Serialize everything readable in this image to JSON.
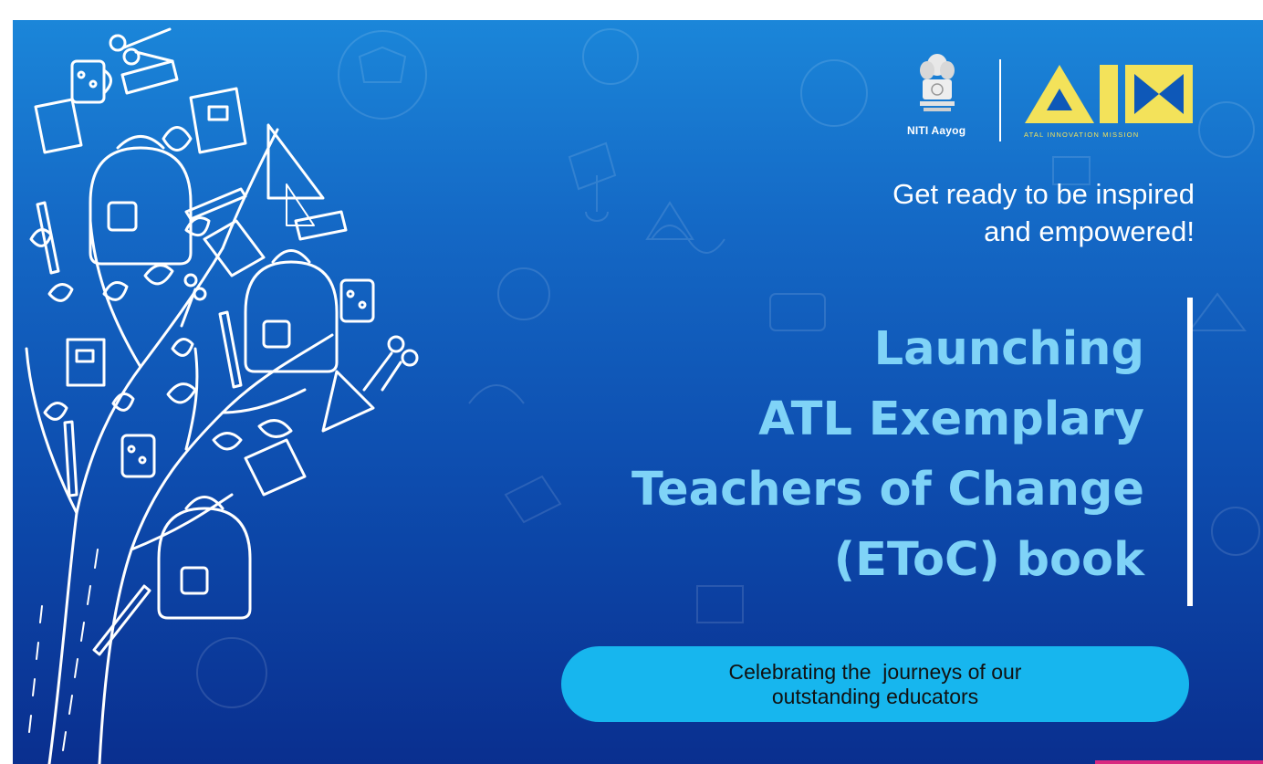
{
  "banner": {
    "subtitle_line1": "Get ready to be inspired",
    "subtitle_line2": "and empowered!",
    "title_lines": [
      "Launching",
      "ATL Exemplary",
      "Teachers of Change",
      "(EToC) book"
    ],
    "pill_line1": "Celebrating the  journeys of our",
    "pill_line2": "outstanding educators"
  },
  "logos": {
    "niti_text": "NITI Aayog",
    "aim_text": "AIM",
    "aim_tagline": "ATAL INNOVATION MISSION"
  },
  "colors": {
    "background_top": "#1b86d9",
    "background_bottom": "#0a2f8f",
    "title": "#7fd3f7",
    "pill": "#17b6ee",
    "aim_yellow": "#f3e25a",
    "accent": "#d9287f"
  },
  "icons": [
    "tree-illustration",
    "backpack-icon",
    "book-icon",
    "pencil-icon",
    "scissors-icon",
    "set-square-icon",
    "ball-icon",
    "national-emblem-icon"
  ]
}
